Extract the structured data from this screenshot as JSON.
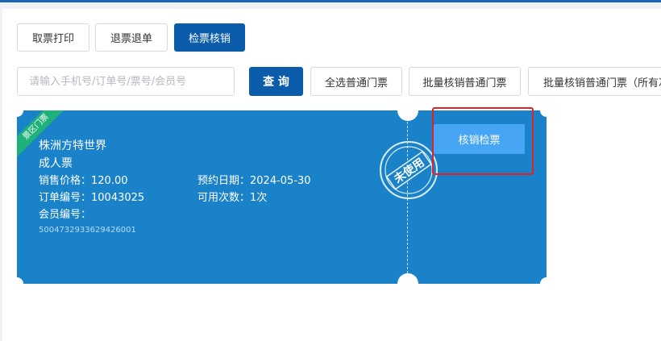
{
  "toolbar": {
    "take_ticket_print": "取票打印",
    "refund_ticket": "退票退单",
    "check_ticket_verify": "检票核销"
  },
  "search": {
    "placeholder": "请输入手机号/订单号/票号/会员号",
    "query_button": "查 询",
    "select_all_regular": "全选普通门票",
    "batch_verify_regular": "批量核销普通门票",
    "batch_verify_regular_all": "批量核销普通门票（所有次数）"
  },
  "ticket": {
    "ribbon": "景区门票",
    "venue": "株洲方特世界",
    "ticket_type": "成人票",
    "price_label": "销售价格：",
    "price": "120.00",
    "reserve_date_label": "预约日期：",
    "reserve_date": "2024-05-30",
    "order_no_label": "订单编号：",
    "order_no": "10043025",
    "available_times_label": "可用次数：",
    "available_times": "1次",
    "member_no_label": "会员编号：",
    "member_no": "",
    "ticket_code": "5004732933629426001",
    "stamp": "未使用",
    "verify_button": "核销检票"
  },
  "colors": {
    "primary": "#0b5dab",
    "ticket_bg": "#1a82c8",
    "verify_button": "#47a5f5",
    "ribbon": "#1eb27a",
    "highlight_box": "#e1222b"
  }
}
